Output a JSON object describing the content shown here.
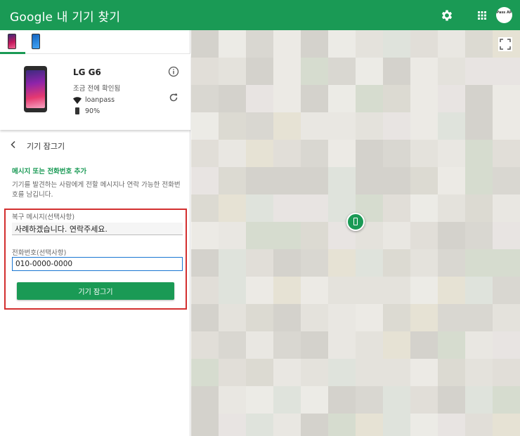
{
  "app": {
    "title": "Google 내 기기 찾기"
  },
  "header": {
    "settings_icon": "gear-icon",
    "apps_icon": "apps-grid-icon",
    "avatar_text": "Pass AP"
  },
  "device": {
    "name": "LG G6",
    "status": "조금 전에 확인됨",
    "wifi": "loanpass",
    "battery": "90%"
  },
  "lock": {
    "title": "기기 잠그기",
    "section_title": "메시지 또는 전화번호 추가",
    "description": "기기를 발견하는 사람에게 전할 메시지나 연락 가능한 전화번호를 남깁니다.",
    "message_label": "복구 메시지(선택사항)",
    "message_value": "사례하겠습니다. 연락주세요.",
    "phone_label": "전화번호(선택사항)",
    "phone_value": "010-0000-0000",
    "button_label": "기기 잠그기"
  },
  "colors": {
    "brand": "#1a9a55",
    "highlight": "#d32f2f",
    "input_focus": "#1976d2"
  }
}
